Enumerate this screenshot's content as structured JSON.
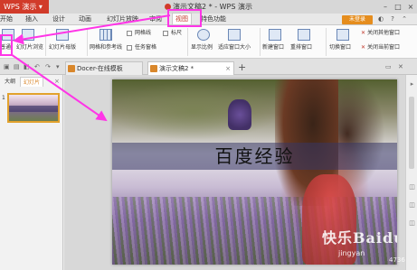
{
  "window": {
    "app_name": "WPS 演示",
    "title": "演示文稿2 * - WPS 演示",
    "minimize": "–",
    "restore": "□",
    "close": "×"
  },
  "menu": {
    "items": [
      "开始",
      "插入",
      "设计",
      "动画",
      "幻灯片放映",
      "审阅",
      "视图",
      "特色功能"
    ],
    "active": "视图",
    "login_button": "未登录"
  },
  "ribbon": {
    "normal": "普通",
    "slide_sorter": "幻灯片浏览",
    "slide_master": "幻灯片母版",
    "gridlines": "网格线",
    "ruler": "标尺",
    "grid_and_guides": "网格和参考线",
    "task_pane": "任务窗格",
    "display_ratio": "显示比例",
    "fit_window": "适应窗口大小",
    "new_window": "新建窗口",
    "arrange_windows": "重排窗口",
    "switch_window": "切换窗口",
    "close_other_windows": "关闭其他窗口",
    "close_current_window": "关闭当前窗口"
  },
  "tabs": [
    {
      "label": "Docer-在线模板",
      "active": false
    },
    {
      "label": "演示文稿2 *",
      "active": true
    }
  ],
  "tab_close": "×",
  "tab_add": "+",
  "left_panel": {
    "tabs": [
      "大纲",
      "幻灯片"
    ],
    "active": "幻灯片",
    "close": "×",
    "slide_number": "1"
  },
  "slide": {
    "title": "百度经验"
  },
  "watermark": {
    "site_name": "快乐Baidu网",
    "url": "jingyan",
    "corner": "4736"
  },
  "colors": {
    "brand": "#d13b2a",
    "highlight": "#ff35e7",
    "login": "#e58d1e",
    "slide_tab_accent": "#d9872b"
  }
}
